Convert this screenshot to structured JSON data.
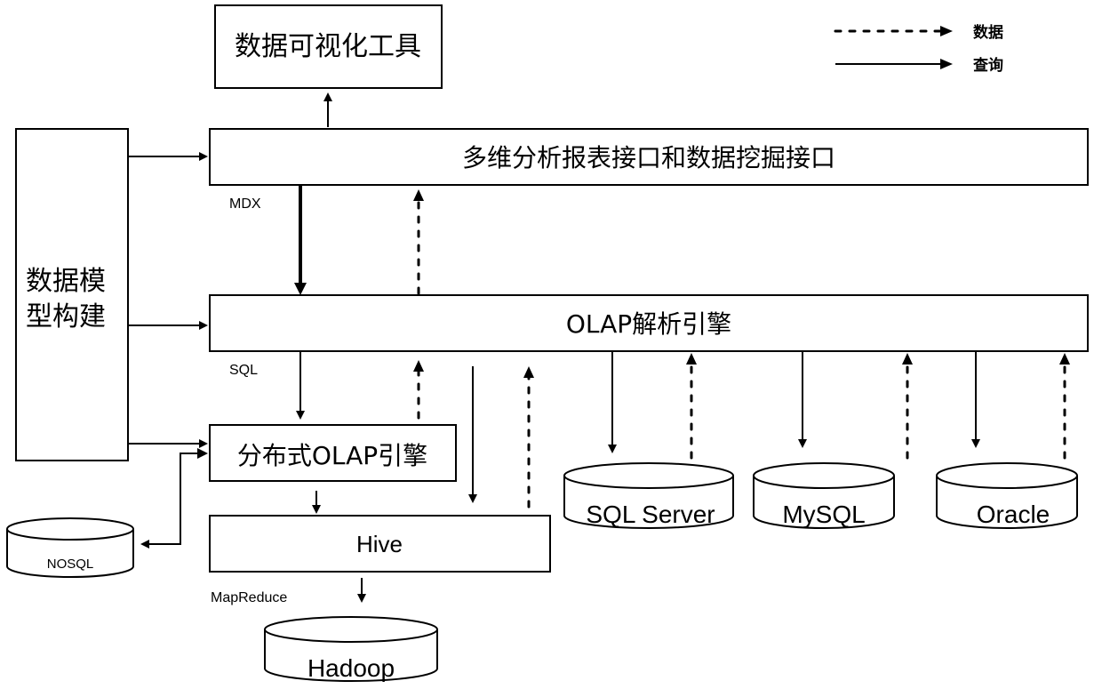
{
  "legend": {
    "data_label": "数据",
    "query_label": "查询"
  },
  "nodes": {
    "viz_tool": "数据可视化工具",
    "interface": "多维分析报表接口和数据挖掘接口",
    "olap_engine": "OLAP解析引擎",
    "data_model_line1": "数据模",
    "data_model_line2": "型构建",
    "distributed_olap": "分布式OLAP引擎",
    "hive": "Hive",
    "nosql": "NOSQL",
    "hadoop": "Hadoop",
    "sql_server": "SQL Server",
    "mysql": "MySQL",
    "oracle": "Oracle"
  },
  "edge_labels": {
    "mdx": "MDX",
    "sql": "SQL",
    "mapreduce": "MapReduce"
  }
}
